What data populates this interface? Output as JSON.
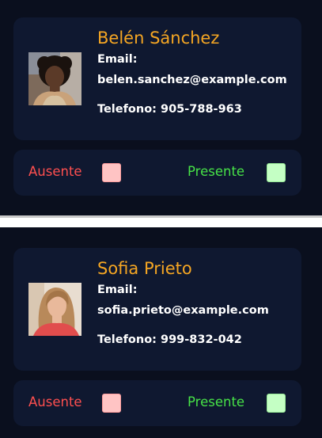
{
  "records": [
    {
      "name": "Belén Sánchez",
      "email_label": "Email:",
      "email": "belen.sanchez@example.com",
      "phone": "Telefono: 905-788-963",
      "absent_label": "Ausente",
      "present_label": "Presente"
    },
    {
      "name": "Sofia Prieto",
      "email_label": "Email:",
      "email": "sofia.prieto@example.com",
      "phone": "Telefono: 999-832-042",
      "absent_label": "Ausente",
      "present_label": "Presente"
    }
  ],
  "colors": {
    "background": "#0a0f1e",
    "card": "#0f1830",
    "name": "#f5a623",
    "absent": "#ff4f4f",
    "absent_box": "#ffc4c4",
    "present": "#47e347",
    "present_box": "#c4ffc4"
  }
}
